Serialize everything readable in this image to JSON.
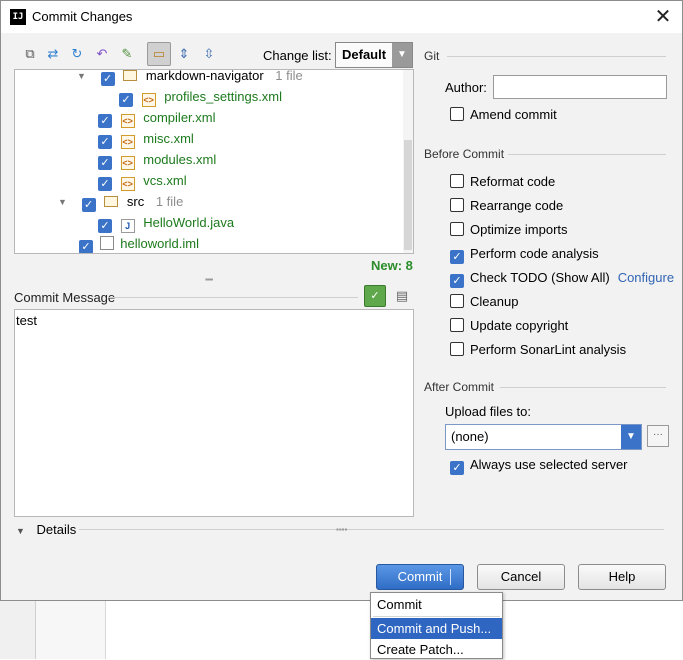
{
  "window": {
    "title": "Commit Changes",
    "app_icon": "IJ",
    "close": "✕"
  },
  "toolbar": {
    "icons": [
      "diff-icon",
      "move-icon",
      "refresh-icon",
      "rollback-icon",
      "edit-source-icon",
      "group-by-directory-icon",
      "expand-all-icon",
      "collapse-all-icon"
    ],
    "changelist_label": "Change list:",
    "changelist_value": "Default"
  },
  "tree": {
    "rows": [
      {
        "name": "markdown-navigator",
        "meta": "1 file"
      },
      {
        "name": "profiles_settings.xml"
      },
      {
        "name": "compiler.xml"
      },
      {
        "name": "misc.xml"
      },
      {
        "name": "modules.xml"
      },
      {
        "name": "vcs.xml"
      },
      {
        "name": "src",
        "meta": "1 file"
      },
      {
        "name": "HelloWorld.java"
      },
      {
        "name": "helloworld.iml"
      }
    ],
    "new_count": "New: 8"
  },
  "commit_message": {
    "label": "Commit Message",
    "value": "test"
  },
  "git": {
    "section": "Git",
    "author_label": "Author:",
    "author_value": "",
    "amend_label": "Amend commit"
  },
  "before_commit": {
    "section": "Before Commit",
    "options": [
      {
        "label": "Reformat code",
        "checked": false
      },
      {
        "label": "Rearrange code",
        "checked": false
      },
      {
        "label": "Optimize imports",
        "checked": false
      },
      {
        "label": "Perform code analysis",
        "checked": true
      },
      {
        "label": "Check TODO (Show All)",
        "checked": true
      },
      {
        "label": "Cleanup",
        "checked": false
      },
      {
        "label": "Update copyright",
        "checked": false
      },
      {
        "label": "Perform SonarLint analysis",
        "checked": false
      }
    ],
    "configure_link": "Configure"
  },
  "after_commit": {
    "section": "After Commit",
    "upload_label": "Upload files to:",
    "upload_value": "(none)",
    "always_label": "Always use selected server",
    "always_checked": true
  },
  "details_label": "Details",
  "buttons": {
    "commit": "Commit",
    "cancel": "Cancel",
    "help": "Help"
  },
  "commit_menu": [
    "Commit",
    "Commit and Push...",
    "Create Patch..."
  ],
  "colors": {
    "accent": "#3b73c9",
    "added_file": "#1c7a1c",
    "new_count": "#2a8d2a",
    "link": "#3165b3"
  }
}
